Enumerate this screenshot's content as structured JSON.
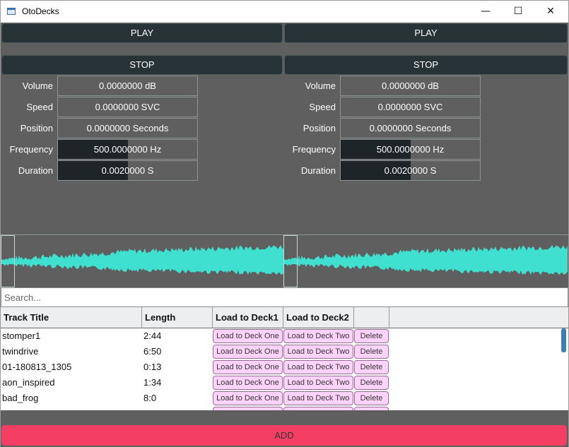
{
  "window": {
    "title": "OtoDecks",
    "minimize_glyph": "—",
    "maximize_glyph": "☐",
    "close_glyph": "✕"
  },
  "colors": {
    "deck_bg": "#5f5f5f",
    "button_bg": "#283337",
    "waveform": "#40e0d0",
    "row_button_bg": "#ffd3fb",
    "add_button_bg": "#f43e63"
  },
  "decks": [
    {
      "play_label": "PLAY",
      "stop_label": "STOP",
      "controls": [
        {
          "label": "Volume",
          "value": "0.0000000 dB",
          "fill_fraction": 0
        },
        {
          "label": "Speed",
          "value": "0.0000000 SVC",
          "fill_fraction": 0
        },
        {
          "label": "Position",
          "value": "0.0000000 Seconds",
          "fill_fraction": 0
        },
        {
          "label": "Frequency",
          "value": "500.0000000 Hz",
          "fill_fraction": 0.5
        },
        {
          "label": "Duration",
          "value": "0.0020000 S",
          "fill_fraction": 0.5
        }
      ]
    },
    {
      "play_label": "PLAY",
      "stop_label": "STOP",
      "controls": [
        {
          "label": "Volume",
          "value": "0.0000000 dB",
          "fill_fraction": 0
        },
        {
          "label": "Speed",
          "value": "0.0000000 SVC",
          "fill_fraction": 0
        },
        {
          "label": "Position",
          "value": "0.0000000 Seconds",
          "fill_fraction": 0
        },
        {
          "label": "Frequency",
          "value": "500.0000000 Hz",
          "fill_fraction": 0.5
        },
        {
          "label": "Duration",
          "value": "0.0020000 S",
          "fill_fraction": 0.5
        }
      ]
    }
  ],
  "search": {
    "placeholder": "Search..."
  },
  "playlist": {
    "headers": [
      "Track Title",
      "Length",
      "Load to Deck1",
      "Load to Deck2",
      ""
    ],
    "load_one_label": "Load to Deck One",
    "load_two_label": "Load to Deck Two",
    "delete_label": "Delete",
    "rows": [
      {
        "title": "stomper1",
        "length": "2:44"
      },
      {
        "title": "twindrive",
        "length": "6:50"
      },
      {
        "title": "01-180813_1305",
        "length": "0:13"
      },
      {
        "title": "aon_inspired",
        "length": "1:34"
      },
      {
        "title": "bad_frog",
        "length": "8:0"
      }
    ]
  },
  "add_label": "ADD"
}
